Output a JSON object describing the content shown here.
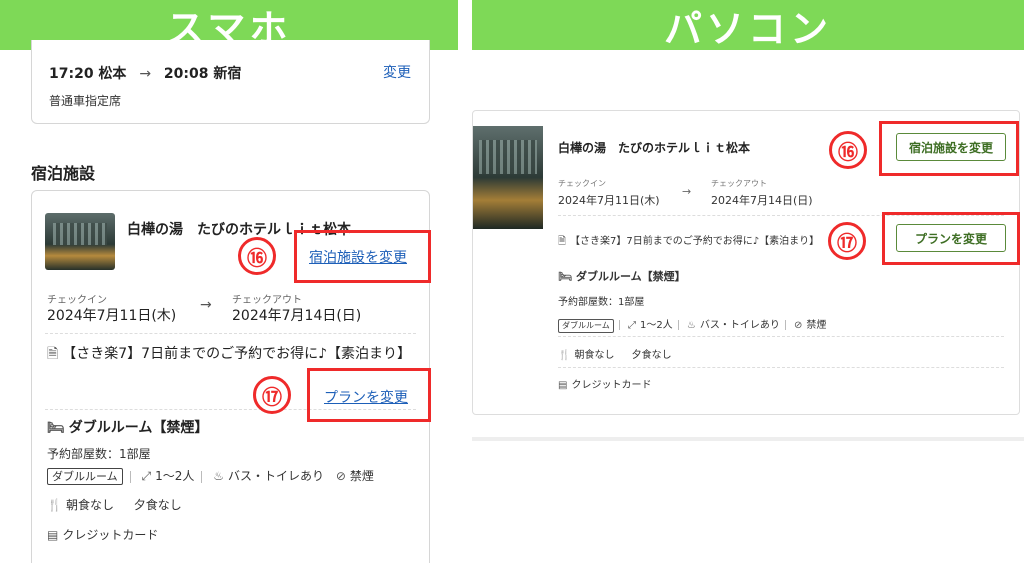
{
  "banners": {
    "left": "スマホ",
    "right": "パソコン"
  },
  "mobile": {
    "train": {
      "route_from": "17:20 松本",
      "arrow": "→",
      "route_to": "20:08 新宿",
      "change_label": "変更",
      "seat": "普通車指定席"
    },
    "section_title": "宿泊施設",
    "hotel": {
      "name": "白樺の湯　たびのホテルｌｉｔ松本",
      "change_hotel_label": "宿泊施設を変更",
      "checkin_label": "チェックイン",
      "checkin_date": "2024年7月11日(木)",
      "arrow": "→",
      "checkout_label": "チェックアウト",
      "checkout_date": "2024年7月14日(日)",
      "plan": "【さき楽7】7日前までのご予約でお得に♪【素泊まり】",
      "change_plan_label": "プランを変更",
      "room": "ダブルルーム【禁煙】",
      "rooms_count": "予約部屋数：1部屋",
      "room_tag": "ダブルルーム",
      "capacity": "1〜2人",
      "bath": "バス・トイレあり",
      "smoking": "禁煙",
      "meals_breakfast": "朝食なし",
      "meals_dinner": "夕食なし",
      "payment": "クレジットカード"
    }
  },
  "pc": {
    "hotel": {
      "name": "白樺の湯　たびのホテルｌｉｔ松本",
      "change_hotel_label": "宿泊施設を変更",
      "checkin_label": "チェックイン",
      "checkin_date": "2024年7月11日(木)",
      "arrow": "→",
      "checkout_label": "チェックアウト",
      "checkout_date": "2024年7月14日(日)",
      "plan": "【さき楽7】7日前までのご予約でお得に♪【素泊まり】",
      "change_plan_label": "プランを変更",
      "room": "ダブルルーム【禁煙】",
      "rooms_count": "予約部屋数：1部屋",
      "room_tag": "ダブルルーム",
      "capacity": "1〜2人",
      "bath": "バス・トイレあり",
      "smoking": "禁煙",
      "meals_breakfast": "朝食なし",
      "meals_dinner": "夕食なし",
      "payment": "クレジットカード"
    }
  },
  "markers": {
    "first": "⑯",
    "second": "⑰"
  },
  "colors": {
    "banner": "#7ed957",
    "link": "#1d5fb8",
    "highlight": "#ef2a2a",
    "button_text": "#3e6e24"
  },
  "icons": [
    "arrow-right-icon",
    "document-icon",
    "bed-icon",
    "resize-icon",
    "bath-icon",
    "no-smoking-icon",
    "cutlery-icon",
    "credit-card-icon"
  ]
}
